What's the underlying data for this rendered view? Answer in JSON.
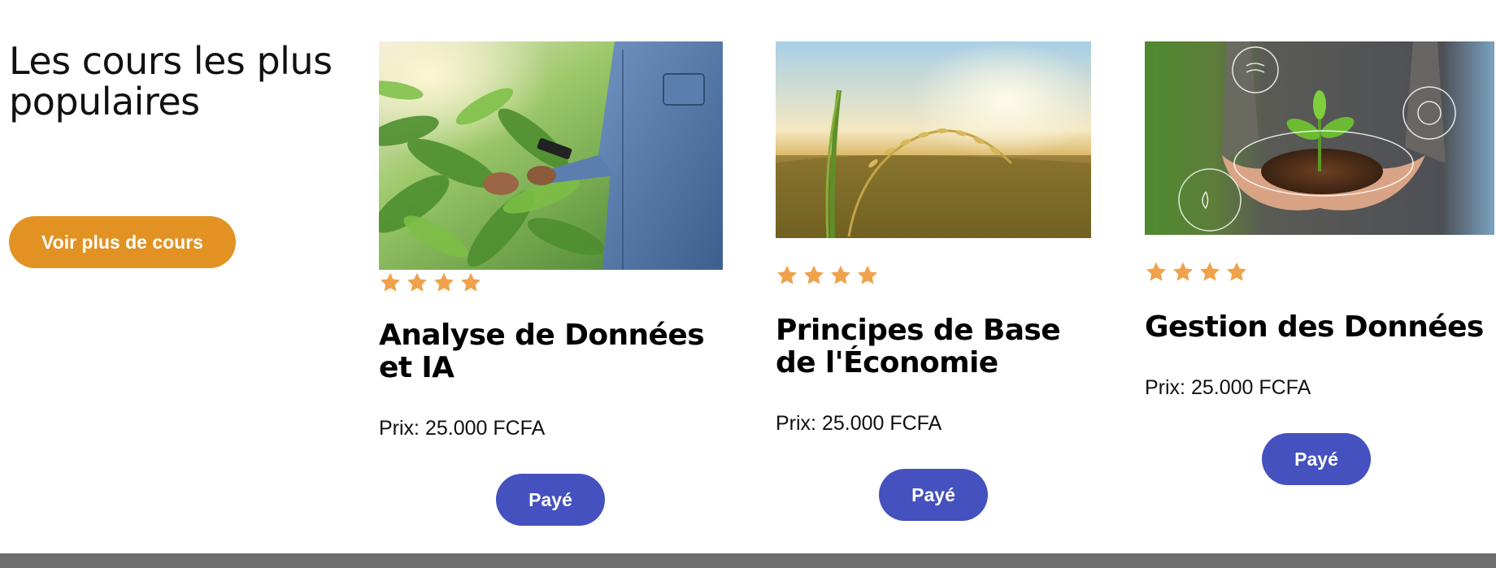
{
  "section": {
    "title": "Les cours les plus populaires",
    "more_label": "Voir plus de cours"
  },
  "courses": [
    {
      "title": "Analyse de Données et IA",
      "price": "Prix: 25.000 FCFA",
      "button": "Payé",
      "rating": 4
    },
    {
      "title": "Principes de Base de l'Économie",
      "price": "Prix: 25.000 FCFA",
      "button": "Payé",
      "rating": 4
    },
    {
      "title": "Gestion des Données",
      "price": "Prix: 25.000 FCFA",
      "button": "Payé",
      "rating": 4
    }
  ],
  "colors": {
    "accent_orange": "#E29223",
    "button_blue": "#4451BE",
    "star": "#EFA14B",
    "footer": "#6E6E6E"
  }
}
